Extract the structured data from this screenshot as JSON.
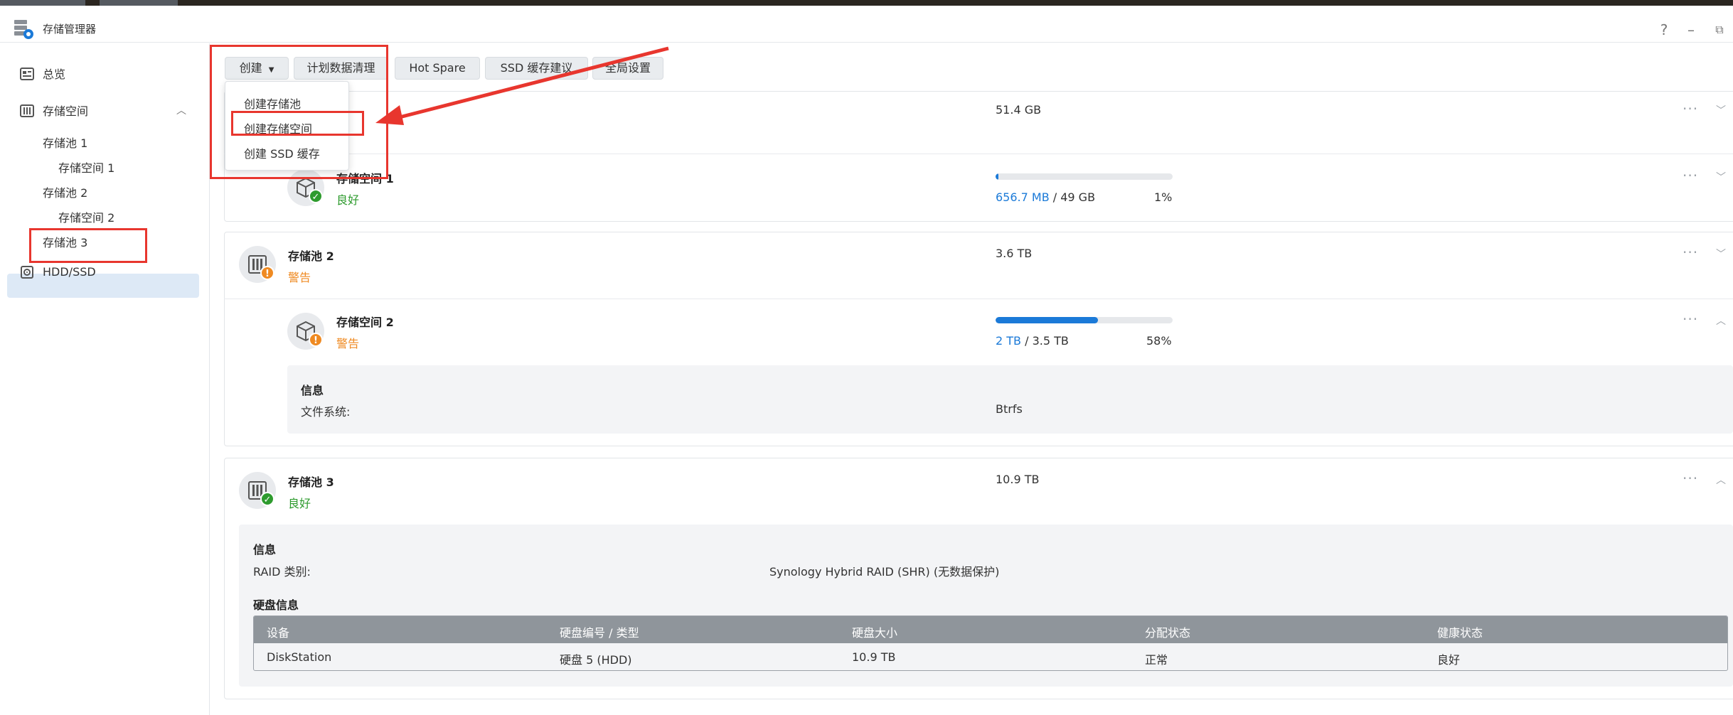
{
  "app": {
    "title": "存储管理器",
    "icon": "storage-manager-icon"
  },
  "window_controls": {
    "help": "?",
    "minimize": "–",
    "restore": "⧉"
  },
  "sidebar": {
    "items": [
      {
        "label": "总览",
        "icon": "overview-icon"
      },
      {
        "label": "存储空间",
        "icon": "storage-icon"
      },
      {
        "label": "存储池 1"
      },
      {
        "label": "存储空间 1"
      },
      {
        "label": "存储池 2"
      },
      {
        "label": "存储空间 2"
      },
      {
        "label": "存储池 3",
        "selected": true
      },
      {
        "label": "HDD/SSD",
        "icon": "disk-icon"
      }
    ]
  },
  "toolbar": {
    "create_label": "创建",
    "scrub_label": "计划数据清理",
    "hotspare_label": "Hot Spare",
    "ssd_advice_label": "SSD 缓存建议",
    "global_settings_label": "全局设置"
  },
  "create_menu": {
    "items": [
      "创建存储池",
      "创建存储空间",
      "创建 SSD 缓存"
    ],
    "highlighted": "创建存储空间"
  },
  "pools": {
    "pool1": {
      "size": "51.4 GB"
    },
    "volume1": {
      "name": "存储空间 1",
      "status": "良好",
      "used": "656.7 MB",
      "sep_total": " / 49 GB",
      "percent_label": "1%",
      "percent": 1
    },
    "pool2": {
      "name": "存储池 2",
      "status": "警告",
      "size": "3.6 TB"
    },
    "volume2": {
      "name": "存储空间 2",
      "status": "警告",
      "used": "2 TB",
      "sep_total": " / 3.5 TB",
      "percent_label": "58%",
      "percent": 58,
      "info_title": "信息",
      "fs_key": "文件系统:",
      "fs_value": "Btrfs"
    },
    "pool3": {
      "name": "存储池 3",
      "status": "良好",
      "size": "10.9 TB",
      "info_title": "信息",
      "raid_key": "RAID 类别:",
      "raid_value": "Synology Hybrid RAID (SHR) (无数据保护)",
      "disk_info_title": "硬盘信息"
    }
  },
  "disk_table": {
    "headers": [
      "设备",
      "硬盘编号 / 类型",
      "硬盘大小",
      "分配状态",
      "健康状态"
    ],
    "rows": [
      [
        "DiskStation",
        "硬盘 5 (HDD)",
        "10.9 TB",
        "正常",
        "良好"
      ]
    ]
  },
  "colors": {
    "accent": "#1b7ad8",
    "good": "#2e9b2e",
    "warn": "#ef8a22",
    "annotation": "#e8362e"
  }
}
